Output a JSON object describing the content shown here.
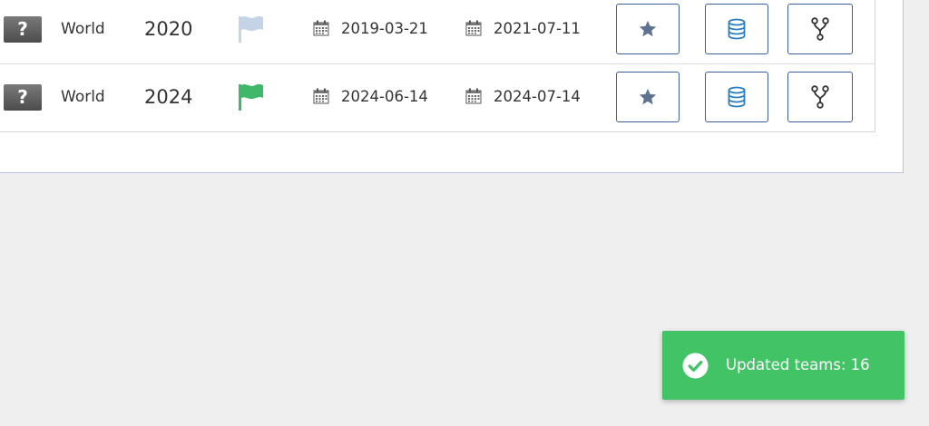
{
  "rows": [
    {
      "region": "World",
      "year": "2020",
      "flag_state": "inactive",
      "flag_color": "#c5d3e6",
      "start_date": "2019-03-21",
      "end_date": "2021-07-11",
      "icons": [
        "question-mark-icon",
        "flag-icon",
        "calendar-icon",
        "star-icon",
        "database-icon",
        "fork-icon"
      ]
    },
    {
      "region": "World",
      "year": "2024",
      "flag_state": "active",
      "flag_color": "#3fb86a",
      "start_date": "2024-06-14",
      "end_date": "2024-07-14",
      "icons": [
        "question-mark-icon",
        "flag-icon",
        "calendar-icon",
        "star-icon",
        "database-icon",
        "fork-icon"
      ]
    }
  ],
  "placeholder_glyph": "?",
  "colors": {
    "button_border": "#3d5fa0",
    "star_icon": "#5f7391",
    "database_icon": "#2a7ec0",
    "fork_icon": "#333333",
    "toast_bg": "#42c466"
  },
  "toast": {
    "message": "Updated teams: 16",
    "icon": "check-circle-icon"
  }
}
